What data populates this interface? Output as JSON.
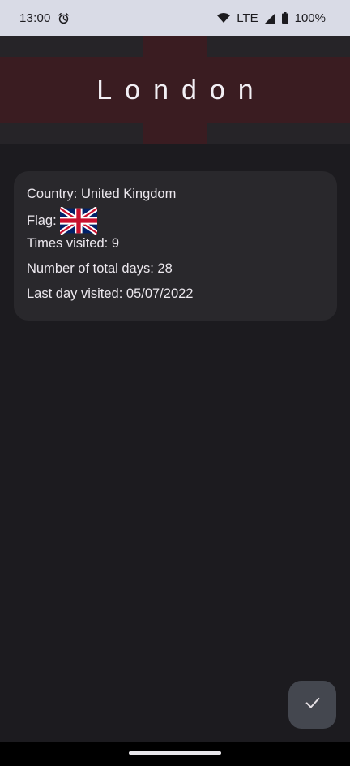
{
  "status_bar": {
    "time": "13:00",
    "network": "LTE",
    "battery": "100%"
  },
  "header": {
    "title": "London"
  },
  "card": {
    "country": "Country: United Kingdom",
    "flag_label": "Flag:",
    "flag_icon": "uk-flag-icon",
    "times_visited": "Times visited: 9",
    "total_days": "Number of total days: 28",
    "last_day": "Last day visited: 05/07/2022"
  },
  "fab": {
    "icon": "check-icon"
  },
  "colors": {
    "background": "#1c1b1f",
    "status_bar": "#d9dbe6",
    "header_cross": "#3a1c21",
    "card": "#29282c",
    "fab": "#44474f"
  }
}
